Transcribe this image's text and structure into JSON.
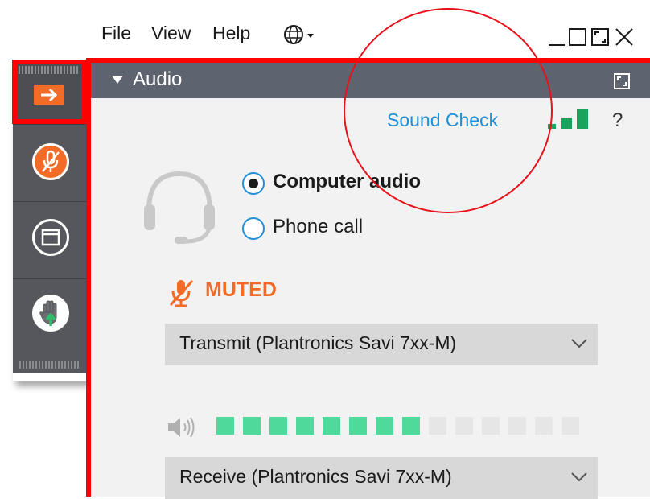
{
  "menubar": {
    "items": [
      "File",
      "View",
      "Help"
    ]
  },
  "icons": {
    "globe": "globe-icon",
    "minimize": "minimize-icon",
    "maximize": "maximize-icon",
    "restore": "restore-icon",
    "close": "close-icon",
    "arrow": "arrow-right-icon",
    "mic_muted": "mic-muted-icon",
    "window": "window-icon",
    "hand": "raise-hand-icon",
    "headset": "headset-icon",
    "speaker": "speaker-icon",
    "signal": "signal-bars-icon",
    "popout": "popout-icon"
  },
  "panel": {
    "title": "Audio",
    "sound_check": "Sound Check",
    "help": "?"
  },
  "audio_mode": {
    "options": [
      {
        "label": "Computer audio",
        "selected": true
      },
      {
        "label": "Phone call",
        "selected": false
      }
    ]
  },
  "mic": {
    "status": "MUTED",
    "device": "Transmit (Plantronics Savi 7xx-M)"
  },
  "speaker": {
    "level_filled": 8,
    "level_total": 14,
    "device": "Receive (Plantronics Savi 7xx-M)"
  },
  "colors": {
    "accent": "#f26b27",
    "link": "#1f8fd6",
    "header": "#5d6470",
    "highlight": "#ff0000",
    "meter_on": "#4fd99a",
    "meter_off": "#e6e6e6"
  }
}
